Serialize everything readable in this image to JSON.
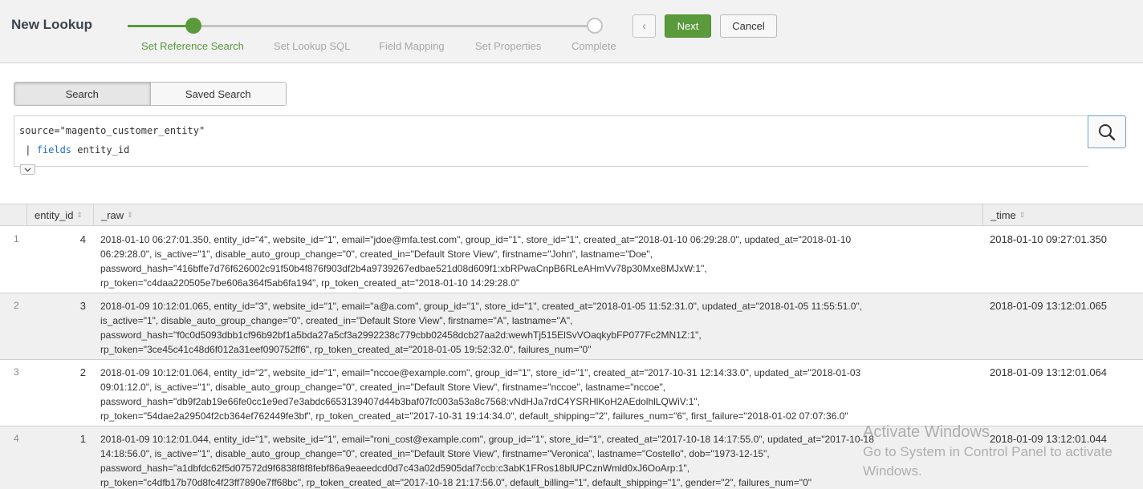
{
  "wizard": {
    "title": "New Lookup",
    "steps": [
      {
        "label": "Set Reference Search"
      },
      {
        "label": "Set Lookup SQL"
      },
      {
        "label": "Field Mapping"
      },
      {
        "label": "Set Properties"
      },
      {
        "label": "Complete"
      }
    ],
    "back_icon": "chevron-left-icon",
    "back_glyph": "‹",
    "next_label": "Next",
    "cancel_label": "Cancel"
  },
  "search_mode": {
    "options": [
      "Search",
      "Saved Search"
    ],
    "selected": "Search"
  },
  "editor": {
    "line1": "source=\"magento_customer_entity\"",
    "line2_pipe": " | ",
    "line2_keyword": "fields",
    "line2_rest": " entity_id",
    "search_icon": "magnifier-icon",
    "expand_icon": "chevron-down-icon"
  },
  "table": {
    "columns": [
      "entity_id",
      "_raw",
      "_time"
    ],
    "sort_glyph": "⇕",
    "rows": [
      {
        "num": "1",
        "entity_id": "4",
        "raw_lines": [
          "2018-01-10 06:27:01.350, entity_id=\"4\", website_id=\"1\", email=\"jdoe@mfa.test.com\", group_id=\"1\", store_id=\"1\", created_at=\"2018-01-10 06:29:28.0\", updated_at=\"2018-01-10",
          "06:29:28.0\", is_active=\"1\", disable_auto_group_change=\"0\", created_in=\"Default Store View\", firstname=\"John\", lastname=\"Doe\",",
          "password_hash=\"416bffe7d76f626002c91f50b4f876f903df2b4a9739267edbae521d08d609f1:xbRPwaCnpB6RLeAHmVv78p30Mxe8MJxW:1\",",
          "rp_token=\"c4daa220505e7be606a364f5ab6fa194\", rp_token_created_at=\"2018-01-10 14:29:28.0\""
        ],
        "time": "2018-01-10 09:27:01.350"
      },
      {
        "num": "2",
        "entity_id": "3",
        "raw_lines": [
          "2018-01-09 10:12:01.065, entity_id=\"3\", website_id=\"1\", email=\"a@a.com\", group_id=\"1\", store_id=\"1\", created_at=\"2018-01-05 11:52:31.0\", updated_at=\"2018-01-05 11:55:51.0\",",
          "is_active=\"1\", disable_auto_group_change=\"0\", created_in=\"Default Store View\", firstname=\"A\", lastname=\"A\",",
          "password_hash=\"f0c0d5093dbb1cf96b92bf1a5bda27a5cf3a2992238c779cbb02458dcb27aa2d:wewhTj515ElSvVOaqkybFP077Fc2MN1Z:1\",",
          "rp_token=\"3ce45c41c48d6f012a31eef090752ff6\", rp_token_created_at=\"2018-01-05 19:52:32.0\", failures_num=\"0\""
        ],
        "time": "2018-01-09 13:12:01.065"
      },
      {
        "num": "3",
        "entity_id": "2",
        "raw_lines": [
          "2018-01-09 10:12:01.064, entity_id=\"2\", website_id=\"1\", email=\"nccoe@example.com\", group_id=\"1\", store_id=\"1\", created_at=\"2017-10-31 12:14:33.0\", updated_at=\"2018-01-03",
          "09:01:12.0\", is_active=\"1\", disable_auto_group_change=\"0\", created_in=\"Default Store View\", firstname=\"nccoe\", lastname=\"nccoe\",",
          "password_hash=\"db9f2ab19e66fe0cc1e9ed7e3abdc6653139407d44b3baf07fc003a53a8c7568:vNdHJa7rdC4YSRHlKoH2AEdolhlLQWiV:1\",",
          "rp_token=\"54dae2a29504f2cb364ef762449fe3bf\", rp_token_created_at=\"2017-10-31 19:14:34.0\", default_shipping=\"2\", failures_num=\"6\", first_failure=\"2018-01-02 07:07:36.0\""
        ],
        "time": "2018-01-09 13:12:01.064"
      },
      {
        "num": "4",
        "entity_id": "1",
        "raw_lines": [
          "2018-01-09 10:12:01.044, entity_id=\"1\", website_id=\"1\", email=\"roni_cost@example.com\", group_id=\"1\", store_id=\"1\", created_at=\"2017-10-18 14:17:55.0\", updated_at=\"2017-10-18",
          "14:18:56.0\", is_active=\"1\", disable_auto_group_change=\"0\", created_in=\"Default Store View\", firstname=\"Veronica\", lastname=\"Costello\", dob=\"1973-12-15\",",
          "password_hash=\"a1dbfdc62f5d07572d9f6838f8f8febf86a9eaeedcd0d7c43a02d5905daf7ccb:c3abK1FRos18blUPCznWmld0xJ6OoArp:1\",",
          "rp_token=\"c4dfb17b70d8fc4f23ff7890e7ff68bc\", rp_token_created_at=\"2017-10-18 21:17:56.0\", default_billing=\"1\", default_shipping=\"1\", gender=\"2\", failures_num=\"0\""
        ],
        "time": "2018-01-09 13:12:01.044"
      }
    ]
  },
  "watermark": {
    "title": "Activate Windows",
    "line1": "Go to System in Control Panel to activate",
    "line2": "Windows."
  },
  "colors": {
    "accent_green": "#5a9a3c",
    "focus_blue": "#6ba3d6",
    "keyword_blue": "#1a6ec8"
  }
}
